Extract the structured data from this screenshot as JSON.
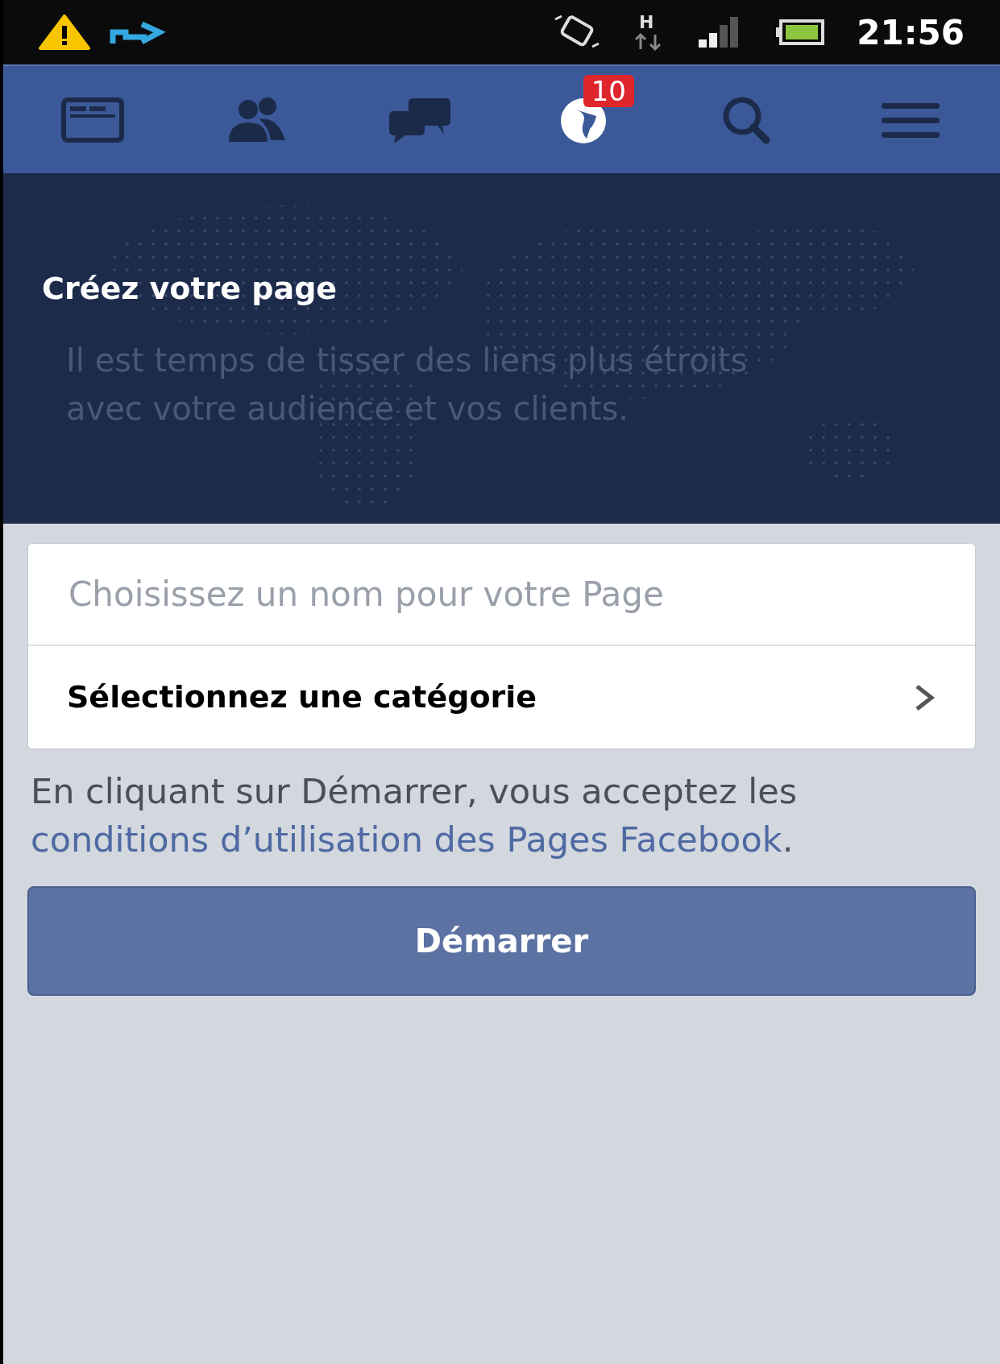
{
  "status_bar": {
    "network_type": "H",
    "time": "21:56"
  },
  "nav_tabs": [
    {
      "kind": "feed",
      "highlighted": false
    },
    {
      "kind": "friends",
      "highlighted": false
    },
    {
      "kind": "messages",
      "highlighted": false
    },
    {
      "kind": "notifications",
      "highlighted": true,
      "badge": "10"
    },
    {
      "kind": "search",
      "highlighted": false
    },
    {
      "kind": "menu",
      "highlighted": false
    }
  ],
  "hero": {
    "title": "Créez votre page",
    "subtitle": "Il est temps de tisser des liens plus étroits avec votre audience et vos clients."
  },
  "form": {
    "name_field": {
      "placeholder": "Choisissez un nom pour votre Page"
    },
    "category": {
      "label": "Sélectionnez une catégorie"
    }
  },
  "terms": {
    "text": "En cliquant sur Démarrer, vous acceptez les ",
    "link": "conditions d’utilisation des Pages Facebook",
    "end": "."
  },
  "start_button": {
    "label": "Démarrer"
  }
}
